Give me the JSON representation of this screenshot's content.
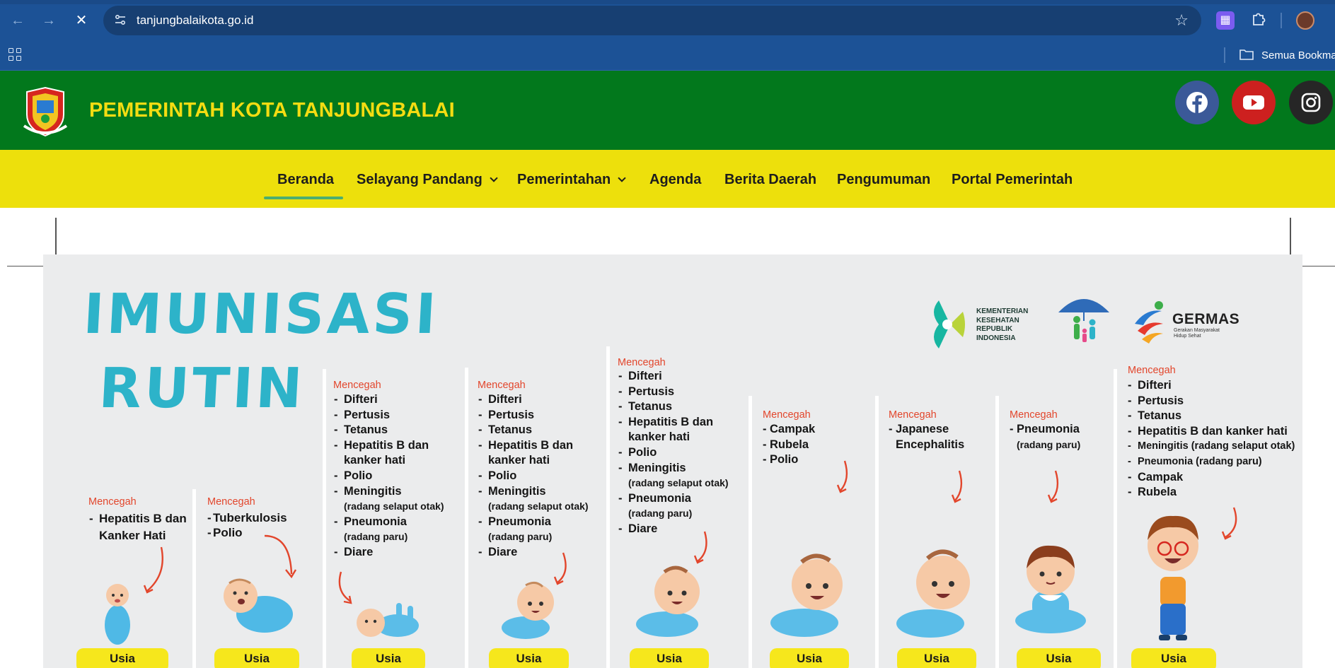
{
  "browser": {
    "url": "tanjungbalaikota.go.id",
    "bookmarks_folder": "Semua Bookma"
  },
  "site": {
    "title": "PEMERINTAH KOTA TANJUNGBALAI"
  },
  "nav": {
    "items": [
      {
        "label": "Beranda",
        "active": true
      },
      {
        "label": "Selayang Pandang",
        "dropdown": true
      },
      {
        "label": "Pemerintahan",
        "dropdown": true
      },
      {
        "label": "Agenda"
      },
      {
        "label": "Berita Daerah"
      },
      {
        "label": "Pengumuman"
      },
      {
        "label": "Portal Pemerintah"
      }
    ]
  },
  "poster": {
    "title_line1": "IMUNISASI",
    "title_line2": "RUTIN",
    "logos": {
      "kemenkes": [
        "KEMENTERIAN",
        "KESEHATAN",
        "REPUBLIK",
        "INDONESIA"
      ],
      "germas": "GERMAS",
      "germas_sub": "Gerakan Masyarakat Hidup Sehat"
    },
    "prevent_label": "Mencegah",
    "usia_label": "Usia",
    "columns": [
      {
        "items": [
          [
            "Hepatitis B dan",
            "Kanker Hati"
          ]
        ]
      },
      {
        "items": [
          [
            "Tuberkulosis"
          ],
          [
            "Polio"
          ]
        ]
      },
      {
        "items": [
          [
            "Difteri"
          ],
          [
            "Pertusis"
          ],
          [
            "Tetanus"
          ],
          [
            "Hepatitis B dan",
            "kanker hati"
          ],
          [
            "Polio"
          ],
          [
            "Meningitis",
            "(radang selaput otak)"
          ],
          [
            "Pneumonia",
            "(radang paru)"
          ],
          [
            "Diare"
          ]
        ]
      },
      {
        "items": [
          [
            "Difteri"
          ],
          [
            "Pertusis"
          ],
          [
            "Tetanus"
          ],
          [
            "Hepatitis B dan",
            "kanker hati"
          ],
          [
            "Polio"
          ],
          [
            "Meningitis",
            "(radang selaput otak)"
          ],
          [
            "Pneumonia",
            "(radang paru)"
          ],
          [
            "Diare"
          ]
        ]
      },
      {
        "items": [
          [
            "Difteri"
          ],
          [
            "Pertusis"
          ],
          [
            "Tetanus"
          ],
          [
            "Hepatitis B dan",
            "kanker hati"
          ],
          [
            "Polio"
          ],
          [
            "Meningitis",
            "(radang selaput otak)"
          ],
          [
            "Pneumonia",
            "(radang paru)"
          ],
          [
            "Diare"
          ]
        ]
      },
      {
        "items": [
          [
            "Campak"
          ],
          [
            "Rubela"
          ],
          [
            "Polio"
          ]
        ]
      },
      {
        "items": [
          [
            "Japanese",
            "Encephalitis"
          ]
        ]
      },
      {
        "items": [
          [
            "Pneumonia",
            "(radang paru)"
          ]
        ]
      },
      {
        "items": [
          [
            "Difteri"
          ],
          [
            "Pertusis"
          ],
          [
            "Tetanus"
          ],
          [
            "Hepatitis B dan kanker hati"
          ],
          [
            "Meningitis (radang selaput otak)"
          ],
          [
            "Pneumonia (radang paru)"
          ],
          [
            "Campak"
          ],
          [
            "Rubela"
          ]
        ]
      }
    ]
  },
  "colors": {
    "browser_chrome": "#1c5296",
    "header_green": "#02781c",
    "title_yellow": "#f4dc12",
    "nav_yellow": "#ede00c",
    "active_underline": "#4cae6e",
    "poster_bg": "#ebeced",
    "poster_title": "#2db3c9",
    "prevent_red": "#e2462c",
    "usia_yellow": "#f6e71c"
  }
}
